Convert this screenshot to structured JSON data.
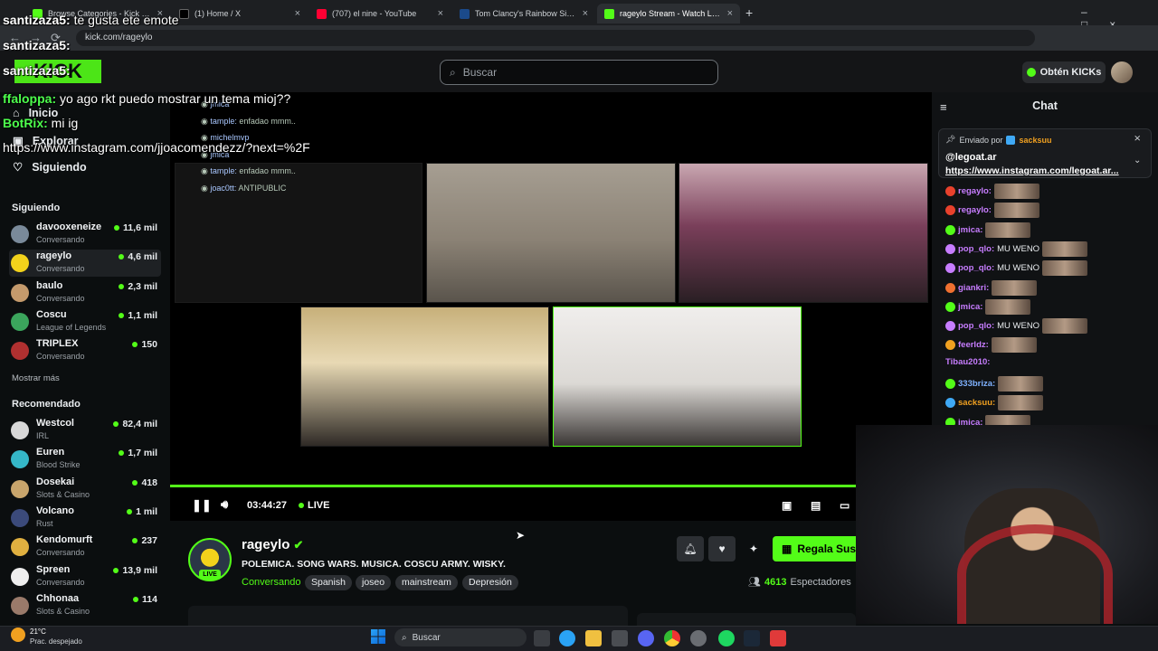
{
  "browser": {
    "tabs": [
      {
        "label": "Browse Categories - Kick Strea",
        "color": "#53fc18"
      },
      {
        "label": "(1) Home / X",
        "color": "#111111"
      },
      {
        "label": "(707) el nine - YouTube",
        "color": "#ff0033"
      },
      {
        "label": "Tom Clancy's Rainbow Six® Sie",
        "color": "#1b4a8a"
      },
      {
        "label": "rageylo Stream - Watch Live",
        "color": "#53fc18"
      }
    ],
    "url": "kick.com/rageylo"
  },
  "header": {
    "search_placeholder": "Buscar",
    "get_kicks": "Obtén KICKs"
  },
  "sidebar": {
    "nav": [
      {
        "label": "Inicio",
        "icon": "home-icon"
      },
      {
        "label": "Explorar",
        "icon": "compass-icon"
      },
      {
        "label": "Siguiendo",
        "icon": "heart-icon"
      }
    ],
    "following_title": "Siguiendo",
    "following": [
      {
        "name": "davooxeneize",
        "category": "Conversando",
        "viewers": "11,6 mil",
        "color": "#7a8a9a"
      },
      {
        "name": "rageylo",
        "category": "Conversando",
        "viewers": "4,6 mil",
        "color": "#f2d21b"
      },
      {
        "name": "baulo",
        "category": "Conversando",
        "viewers": "2,3 mil",
        "color": "#c49a6c"
      },
      {
        "name": "Coscu",
        "category": "League of Legends",
        "viewers": "1,1 mil",
        "color": "#3ba55c"
      },
      {
        "name": "TRIPLEX",
        "category": "Conversando",
        "viewers": "150",
        "color": "#b03030"
      }
    ],
    "show_more": "Mostrar más",
    "recommended_title": "Recomendado",
    "recommended": [
      {
        "name": "Westcol",
        "category": "IRL",
        "viewers": "82,4 mil",
        "color": "#d8d8d8"
      },
      {
        "name": "Euren",
        "category": "Blood Strike",
        "viewers": "1,7 mil",
        "color": "#35b7c8"
      },
      {
        "name": "Dosekai",
        "category": "Slots & Casino",
        "viewers": "418",
        "color": "#c8a56c"
      },
      {
        "name": "Volcano",
        "category": "Rust",
        "viewers": "1 mil",
        "color": "#3b4a7a"
      },
      {
        "name": "Kendomurft",
        "category": "Conversando",
        "viewers": "237",
        "color": "#e0b040"
      },
      {
        "name": "Spreen",
        "category": "Conversando",
        "viewers": "13,9 mil",
        "color": "#eeeeee"
      },
      {
        "name": "Chhonaa",
        "category": "Slots & Casino",
        "viewers": "114",
        "color": "#9a7a6a"
      }
    ]
  },
  "player": {
    "time": "03:44:27",
    "live": "LIVE",
    "overlay_chat": [
      {
        "user": "jmica",
        "text": ""
      },
      {
        "user": "tample",
        "text": "enfadao mmm.."
      },
      {
        "user": "michelmvp",
        "text": ""
      },
      {
        "user": "jmica",
        "text": ""
      },
      {
        "user": "tample",
        "text": "enfadao mmm.."
      },
      {
        "user": "joac0tt",
        "text": "ANTIPUBLIC"
      }
    ]
  },
  "big_overlay": [
    {
      "user": "santizaza5",
      "text": "te gusta ete emote",
      "color": "#ffffff"
    },
    {
      "user": "santizaza5",
      "text": "",
      "color": "#ffffff"
    },
    {
      "user": "santizaza5",
      "text": "",
      "color": "#ffffff"
    },
    {
      "user": "ffaloppa",
      "text": "yo ago rkt puedo mostrar un tema mioj??",
      "color": "#4dff4d"
    },
    {
      "user": "BotRix",
      "text": "mi ig",
      "color": "#4dff4d"
    },
    {
      "user": "",
      "text": "https://www.instagram.com/jjoacomendezz/?next=%2F",
      "color": "#ffffff"
    }
  ],
  "streamer": {
    "name": "rageylo",
    "title": "POLEMICA. SONG WARS. MUSICA. COSCU ARMY. WISKY.",
    "category": "Conversando",
    "tags": [
      "Spanish",
      "joseo",
      "mainstream",
      "Depresión"
    ],
    "live_badge": "LIVE",
    "subscribe_label": "Regala Susc",
    "viewers_count": "4613",
    "viewers_label": "Espectadores"
  },
  "chat": {
    "title": "Chat",
    "pinned": {
      "sent_by": "Enviado por",
      "sender": "sacksuu",
      "text": "@legoat.ar",
      "link": "https://www.instagram.com/legoat.ar..."
    },
    "messages": [
      {
        "user": "regaylo",
        "text": "",
        "color": "#c77dff",
        "emote": true
      },
      {
        "user": "regaylo",
        "text": "",
        "color": "#c77dff",
        "emote": true
      },
      {
        "user": "jmica",
        "text": "",
        "color": "#c77dff",
        "emote": true
      },
      {
        "user": "pop_qlo",
        "text": "MU WENO",
        "color": "#c77dff",
        "emote": true
      },
      {
        "user": "pop_qlo",
        "text": "MU WENO",
        "color": "#c77dff",
        "emote": true
      },
      {
        "user": "giankri",
        "text": "",
        "color": "#c77dff",
        "emote": true
      },
      {
        "user": "jmica",
        "text": "",
        "color": "#c77dff",
        "emote": true
      },
      {
        "user": "pop_qlo",
        "text": "MU WENO",
        "color": "#c77dff",
        "emote": true
      },
      {
        "user": "feerldz",
        "text": "",
        "color": "#c77dff",
        "emote": true
      },
      {
        "user": "Tibau2010",
        "text": "",
        "color": "#c77dff",
        "emote": false
      },
      {
        "user": "333briza",
        "text": "",
        "color": "#7fb2ff",
        "emote": true
      },
      {
        "user": "sacksuu",
        "text": "",
        "color": "#f0a020",
        "emote": true
      },
      {
        "user": "jmica",
        "text": "",
        "color": "#c77dff",
        "emote": true
      }
    ]
  },
  "taskbar": {
    "weather_temp": "21°C",
    "weather_desc": "Prac. despejado",
    "search": "Buscar"
  },
  "colors": {
    "accent": "#53fc18",
    "bg": "#0b0e0f"
  }
}
